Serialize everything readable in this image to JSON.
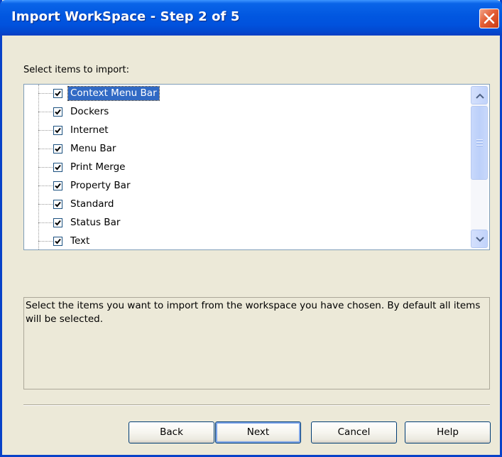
{
  "window": {
    "title": "Import WorkSpace - Step 2 of 5"
  },
  "prompt_label": "Select items to import:",
  "tree": {
    "items": [
      {
        "label": "Context Menu Bar",
        "checked": true,
        "selected": true
      },
      {
        "label": "Dockers",
        "checked": true,
        "selected": false
      },
      {
        "label": "Internet",
        "checked": true,
        "selected": false
      },
      {
        "label": "Menu Bar",
        "checked": true,
        "selected": false
      },
      {
        "label": "Print Merge",
        "checked": true,
        "selected": false
      },
      {
        "label": "Property Bar",
        "checked": true,
        "selected": false
      },
      {
        "label": "Standard",
        "checked": true,
        "selected": false
      },
      {
        "label": "Status Bar",
        "checked": true,
        "selected": false
      },
      {
        "label": "Text",
        "checked": true,
        "selected": false
      }
    ]
  },
  "description": "Select the items you want to import from the workspace you have chosen. By default all items will be selected.",
  "buttons": {
    "back": "Back",
    "next": "Next",
    "cancel": "Cancel",
    "help": "Help"
  },
  "colors": {
    "title_bar": "#0157e0",
    "selection": "#316ac5",
    "close_button": "#e35e35"
  }
}
